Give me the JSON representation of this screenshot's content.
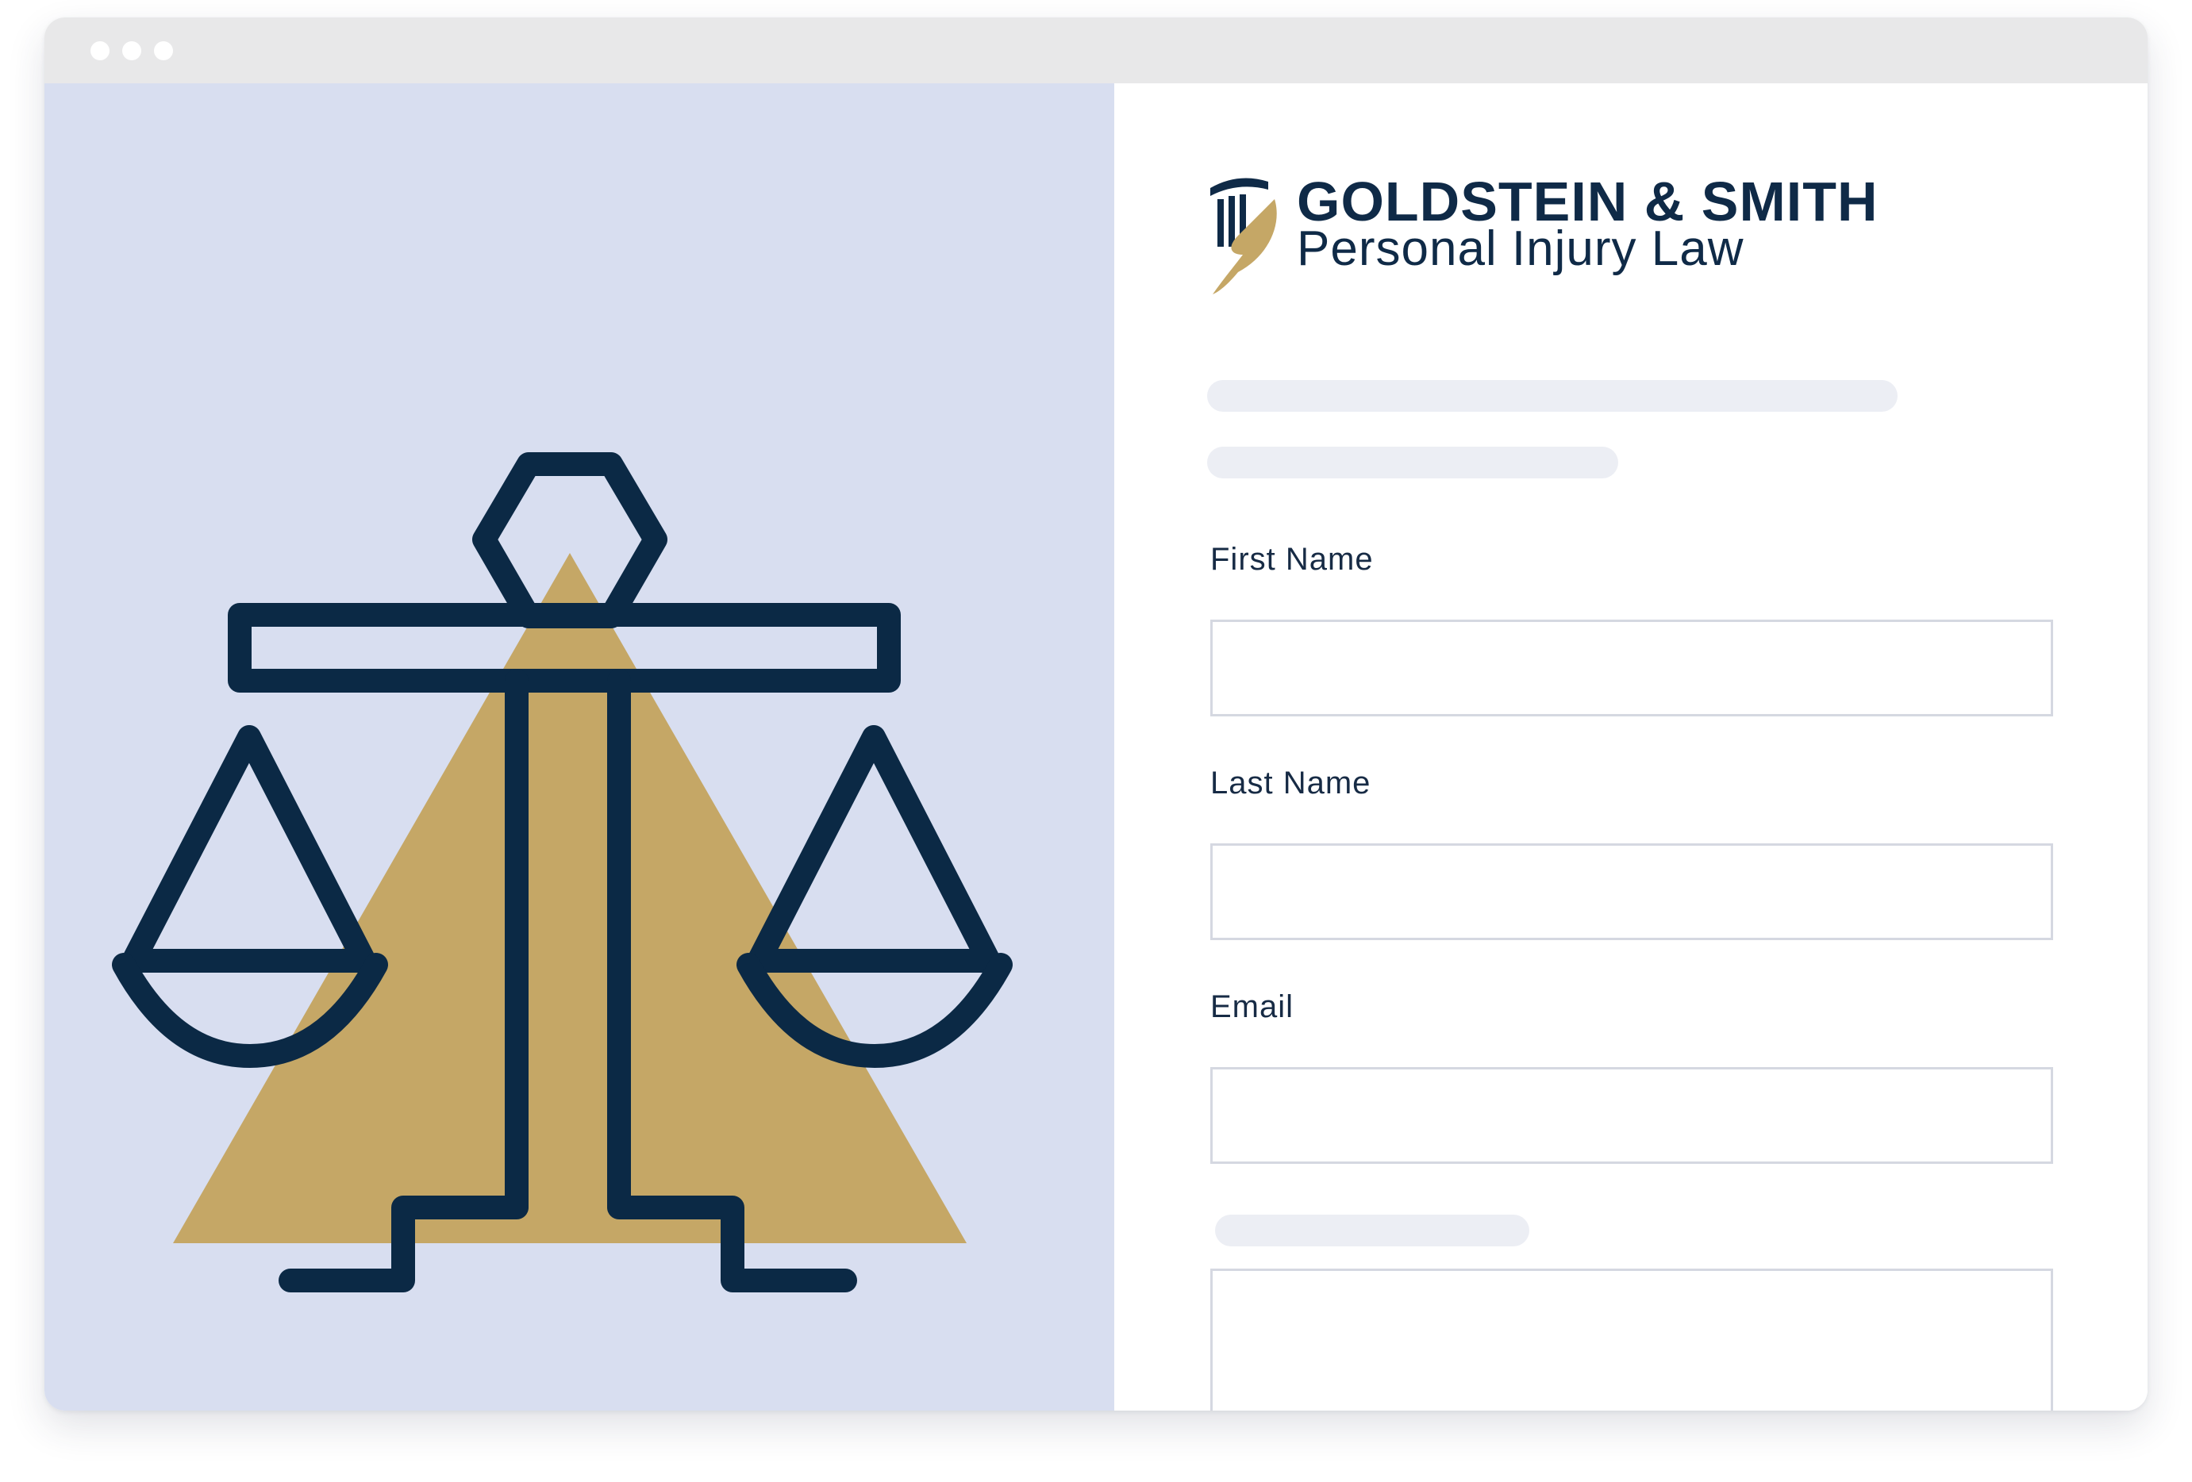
{
  "window": {
    "controls": [
      "window-dot",
      "window-dot",
      "window-dot"
    ]
  },
  "hero": {
    "illustration_icon": "scales-of-justice-icon",
    "colors": {
      "background": "#d8def0",
      "triangle": "#c5a766",
      "stroke": "#0b2945"
    }
  },
  "brand": {
    "name": "GOLDSTEIN & SMITH",
    "tagline": "Personal Injury Law",
    "logo_icon": "column-quill-logo-icon",
    "colors": {
      "navy": "#0f2a47",
      "gold": "#c5a766"
    }
  },
  "form": {
    "fields": [
      {
        "label": "First Name",
        "value": "",
        "placeholder": ""
      },
      {
        "label": "Last Name",
        "value": "",
        "placeholder": ""
      },
      {
        "label": "Email",
        "value": "",
        "placeholder": ""
      }
    ],
    "message": {
      "value": ""
    }
  }
}
